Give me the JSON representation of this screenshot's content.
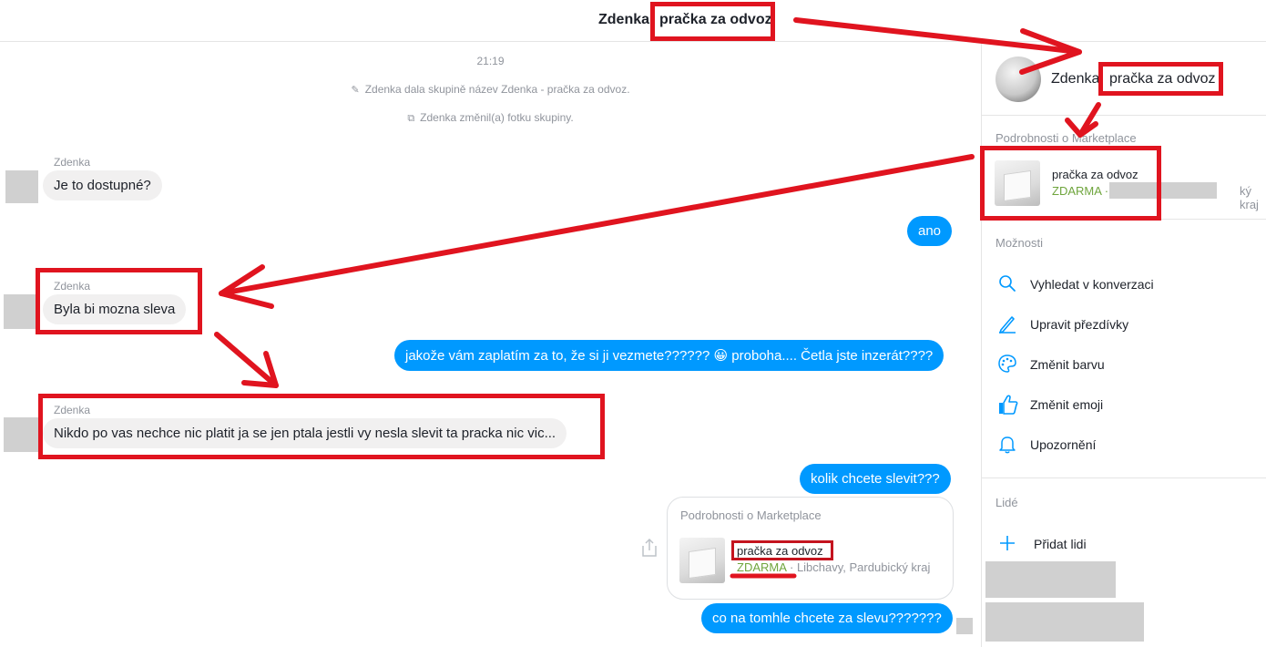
{
  "header": {
    "name": "Zdenka",
    "title": "pračka za odvoz"
  },
  "conversation": {
    "timestamp": "21:19",
    "system": [
      "Zdenka dala skupině název Zdenka - pračka za odvoz.",
      "Zdenka změnil(a) fotku skupiny."
    ],
    "messages": [
      {
        "sender": "Zdenka",
        "text": "Je to dostupné?"
      },
      {
        "text": "ano"
      },
      {
        "sender": "Zdenka",
        "text": "Byla bi mozna sleva"
      },
      {
        "text": "jakože vám zaplatím za to, že si ji vezmete?????? 😀 proboha.... Četla jste inzerát????"
      },
      {
        "sender": "Zdenka",
        "text": "Nikdo po vas nechce nic platit ja se jen ptala jestli vy nesla slevit ta pracka nic vic..."
      },
      {
        "text": "kolik chcete slevit???"
      },
      {
        "text": "co na tomhle chcete za slevu???????"
      }
    ],
    "marketplace_card": {
      "heading": "Podrobnosti o Marketplace",
      "title": "pračka za odvoz",
      "price": "ZDARMA",
      "location": "· Libchavy, Pardubický kraj"
    }
  },
  "sidebar": {
    "name": "Zdenka",
    "title": "pračka za odvoz",
    "marketplace_heading": "Podrobnosti o Marketplace",
    "marketplace_title": "pračka za odvoz",
    "marketplace_price": "ZDARMA ·",
    "marketplace_location_tail": "ký kraj",
    "options_heading": "Možnosti",
    "options": [
      {
        "icon": "search-icon",
        "label": "Vyhledat v konverzaci"
      },
      {
        "icon": "pencil-icon",
        "label": "Upravit přezdívky"
      },
      {
        "icon": "palette-icon",
        "label": "Změnit barvu"
      },
      {
        "icon": "thumbs-up-icon",
        "label": "Změnit emoji"
      },
      {
        "icon": "bell-icon",
        "label": "Upozornění"
      }
    ],
    "people_heading": "Lidé",
    "add_people": "Přidat lidi"
  },
  "colors": {
    "accent": "#0099ff",
    "price_green": "#6fa53d",
    "annotation_red": "#e0141f",
    "muted": "#90949c"
  }
}
